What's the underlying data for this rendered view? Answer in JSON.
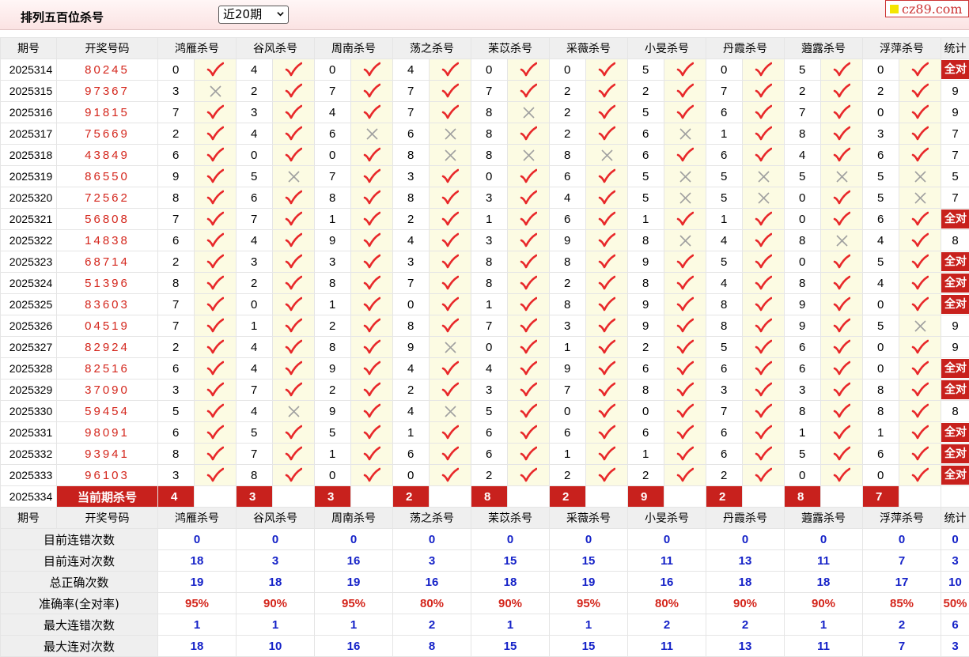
{
  "header": {
    "title": "排列五百位杀号",
    "select_value": "近20期",
    "logo_text": "cz89.com"
  },
  "columns": {
    "issue": "期号",
    "draw": "开奖号码",
    "experts": [
      "鸿雁杀号",
      "谷风杀号",
      "周南杀号",
      "荡之杀号",
      "苿苡杀号",
      "采薇杀号",
      "小旻杀号",
      "丹霞杀号",
      "蕸露杀号",
      "浮萍杀号"
    ],
    "stat": "统计"
  },
  "all_right_label": "全对",
  "icons": {
    "hit": "check-icon",
    "miss": "cross-icon",
    "check_color": "#e8282a",
    "cross_color": "#a0a0a0",
    "accent": "#c8211d"
  },
  "rows": [
    {
      "issue": "2025314",
      "draw": "80245",
      "kills": [
        "0",
        "4",
        "0",
        "4",
        "0",
        "0",
        "5",
        "0",
        "5",
        "0"
      ],
      "hits": [
        true,
        true,
        true,
        true,
        true,
        true,
        true,
        true,
        true,
        true
      ],
      "stat": "全对"
    },
    {
      "issue": "2025315",
      "draw": "97367",
      "kills": [
        "3",
        "2",
        "7",
        "7",
        "7",
        "2",
        "2",
        "7",
        "2",
        "2"
      ],
      "hits": [
        false,
        true,
        true,
        true,
        true,
        true,
        true,
        true,
        true,
        true
      ],
      "stat": "9"
    },
    {
      "issue": "2025316",
      "draw": "91815",
      "kills": [
        "7",
        "3",
        "4",
        "7",
        "8",
        "2",
        "5",
        "6",
        "7",
        "0"
      ],
      "hits": [
        true,
        true,
        true,
        true,
        false,
        true,
        true,
        true,
        true,
        true
      ],
      "stat": "9"
    },
    {
      "issue": "2025317",
      "draw": "75669",
      "kills": [
        "2",
        "4",
        "6",
        "6",
        "8",
        "2",
        "6",
        "1",
        "8",
        "3"
      ],
      "hits": [
        true,
        true,
        false,
        false,
        true,
        true,
        false,
        true,
        true,
        true
      ],
      "stat": "7"
    },
    {
      "issue": "2025318",
      "draw": "43849",
      "kills": [
        "6",
        "0",
        "0",
        "8",
        "8",
        "8",
        "6",
        "6",
        "4",
        "6"
      ],
      "hits": [
        true,
        true,
        true,
        false,
        false,
        false,
        true,
        true,
        true,
        true
      ],
      "stat": "7"
    },
    {
      "issue": "2025319",
      "draw": "86550",
      "kills": [
        "9",
        "5",
        "7",
        "3",
        "0",
        "6",
        "5",
        "5",
        "5",
        "5"
      ],
      "hits": [
        true,
        false,
        true,
        true,
        true,
        true,
        false,
        false,
        false,
        false
      ],
      "stat": "5"
    },
    {
      "issue": "2025320",
      "draw": "72562",
      "kills": [
        "8",
        "6",
        "8",
        "8",
        "3",
        "4",
        "5",
        "5",
        "0",
        "5"
      ],
      "hits": [
        true,
        true,
        true,
        true,
        true,
        true,
        false,
        false,
        true,
        false
      ],
      "stat": "7"
    },
    {
      "issue": "2025321",
      "draw": "56808",
      "kills": [
        "7",
        "7",
        "1",
        "2",
        "1",
        "6",
        "1",
        "1",
        "0",
        "6"
      ],
      "hits": [
        true,
        true,
        true,
        true,
        true,
        true,
        true,
        true,
        true,
        true
      ],
      "stat": "全对"
    },
    {
      "issue": "2025322",
      "draw": "14838",
      "kills": [
        "6",
        "4",
        "9",
        "4",
        "3",
        "9",
        "8",
        "4",
        "8",
        "4"
      ],
      "hits": [
        true,
        true,
        true,
        true,
        true,
        true,
        false,
        true,
        false,
        true
      ],
      "stat": "8"
    },
    {
      "issue": "2025323",
      "draw": "68714",
      "kills": [
        "2",
        "3",
        "3",
        "3",
        "8",
        "8",
        "9",
        "5",
        "0",
        "5"
      ],
      "hits": [
        true,
        true,
        true,
        true,
        true,
        true,
        true,
        true,
        true,
        true
      ],
      "stat": "全对"
    },
    {
      "issue": "2025324",
      "draw": "51396",
      "kills": [
        "8",
        "2",
        "8",
        "7",
        "8",
        "2",
        "8",
        "4",
        "8",
        "4"
      ],
      "hits": [
        true,
        true,
        true,
        true,
        true,
        true,
        true,
        true,
        true,
        true
      ],
      "stat": "全对"
    },
    {
      "issue": "2025325",
      "draw": "83603",
      "kills": [
        "7",
        "0",
        "1",
        "0",
        "1",
        "8",
        "9",
        "8",
        "9",
        "0"
      ],
      "hits": [
        true,
        true,
        true,
        true,
        true,
        true,
        true,
        true,
        true,
        true
      ],
      "stat": "全对"
    },
    {
      "issue": "2025326",
      "draw": "04519",
      "kills": [
        "7",
        "1",
        "2",
        "8",
        "7",
        "3",
        "9",
        "8",
        "9",
        "5"
      ],
      "hits": [
        true,
        true,
        true,
        true,
        true,
        true,
        true,
        true,
        true,
        false
      ],
      "stat": "9"
    },
    {
      "issue": "2025327",
      "draw": "82924",
      "kills": [
        "2",
        "4",
        "8",
        "9",
        "0",
        "1",
        "2",
        "5",
        "6",
        "0"
      ],
      "hits": [
        true,
        true,
        true,
        false,
        true,
        true,
        true,
        true,
        true,
        true
      ],
      "stat": "9"
    },
    {
      "issue": "2025328",
      "draw": "82516",
      "kills": [
        "6",
        "4",
        "9",
        "4",
        "4",
        "9",
        "6",
        "6",
        "6",
        "0"
      ],
      "hits": [
        true,
        true,
        true,
        true,
        true,
        true,
        true,
        true,
        true,
        true
      ],
      "stat": "全对"
    },
    {
      "issue": "2025329",
      "draw": "37090",
      "kills": [
        "3",
        "7",
        "2",
        "2",
        "3",
        "7",
        "8",
        "3",
        "3",
        "8"
      ],
      "hits": [
        true,
        true,
        true,
        true,
        true,
        true,
        true,
        true,
        true,
        true
      ],
      "stat": "全对"
    },
    {
      "issue": "2025330",
      "draw": "59454",
      "kills": [
        "5",
        "4",
        "9",
        "4",
        "5",
        "0",
        "0",
        "7",
        "8",
        "8"
      ],
      "hits": [
        true,
        false,
        true,
        false,
        true,
        true,
        true,
        true,
        true,
        true
      ],
      "stat": "8"
    },
    {
      "issue": "2025331",
      "draw": "98091",
      "kills": [
        "6",
        "5",
        "5",
        "1",
        "6",
        "6",
        "6",
        "6",
        "1",
        "1"
      ],
      "hits": [
        true,
        true,
        true,
        true,
        true,
        true,
        true,
        true,
        true,
        true
      ],
      "stat": "全对"
    },
    {
      "issue": "2025332",
      "draw": "93941",
      "kills": [
        "8",
        "7",
        "1",
        "6",
        "6",
        "1",
        "1",
        "6",
        "5",
        "6"
      ],
      "hits": [
        true,
        true,
        true,
        true,
        true,
        true,
        true,
        true,
        true,
        true
      ],
      "stat": "全对"
    },
    {
      "issue": "2025333",
      "draw": "96103",
      "kills": [
        "3",
        "8",
        "0",
        "0",
        "2",
        "2",
        "2",
        "2",
        "0",
        "0"
      ],
      "hits": [
        true,
        true,
        true,
        true,
        true,
        true,
        true,
        true,
        true,
        true
      ],
      "stat": "全对"
    }
  ],
  "current": {
    "issue": "2025334",
    "label": "当前期杀号",
    "kills": [
      "4",
      "3",
      "3",
      "2",
      "8",
      "2",
      "9",
      "2",
      "8",
      "7"
    ]
  },
  "summary": [
    {
      "label": "目前连错次数",
      "values": [
        "0",
        "0",
        "0",
        "0",
        "0",
        "0",
        "0",
        "0",
        "0",
        "0"
      ],
      "stat": "0",
      "red": false
    },
    {
      "label": "目前连对次数",
      "values": [
        "18",
        "3",
        "16",
        "3",
        "15",
        "15",
        "11",
        "13",
        "11",
        "7"
      ],
      "stat": "3",
      "red": false
    },
    {
      "label": "总正确次数",
      "values": [
        "19",
        "18",
        "19",
        "16",
        "18",
        "19",
        "16",
        "18",
        "18",
        "17"
      ],
      "stat": "10",
      "red": false
    },
    {
      "label": "准确率(全对率)",
      "values": [
        "95%",
        "90%",
        "95%",
        "80%",
        "90%",
        "95%",
        "80%",
        "90%",
        "90%",
        "85%"
      ],
      "stat": "50%",
      "red": true
    },
    {
      "label": "最大连错次数",
      "values": [
        "1",
        "1",
        "1",
        "2",
        "1",
        "1",
        "2",
        "2",
        "1",
        "2"
      ],
      "stat": "6",
      "red": false
    },
    {
      "label": "最大连对次数",
      "values": [
        "18",
        "10",
        "16",
        "8",
        "15",
        "15",
        "11",
        "13",
        "11",
        "7"
      ],
      "stat": "3",
      "red": false
    }
  ]
}
